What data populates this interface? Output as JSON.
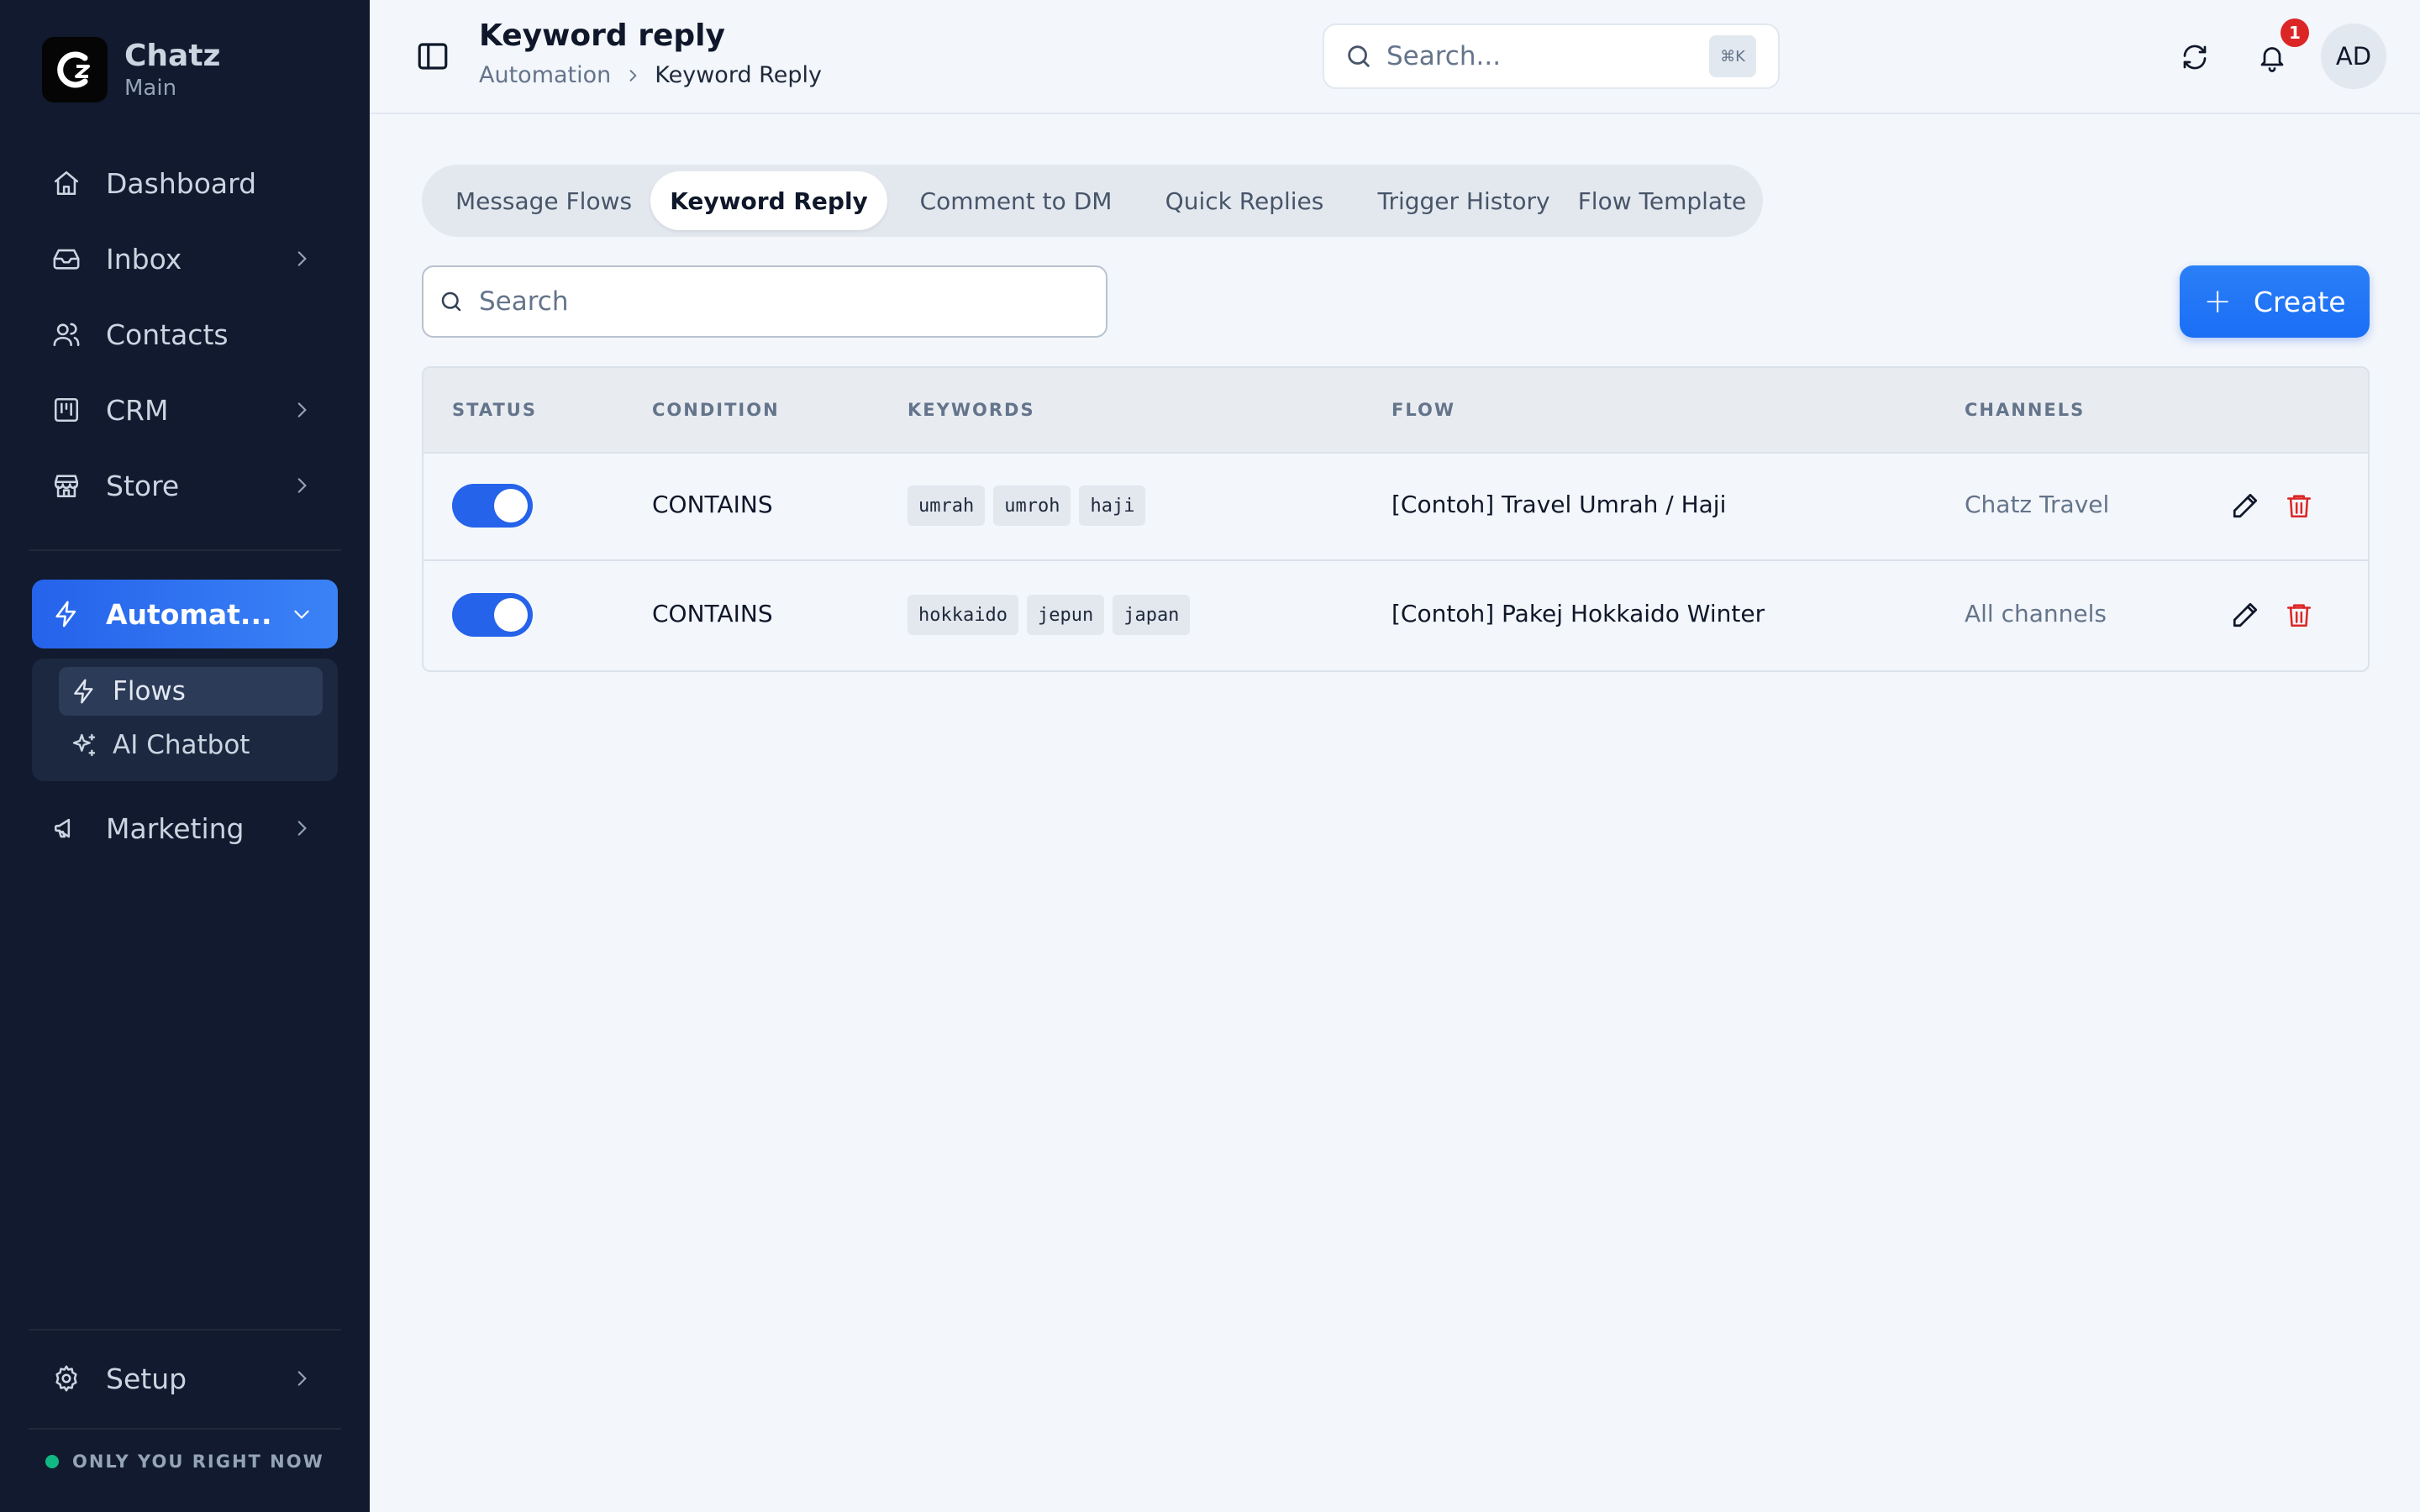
{
  "brand": {
    "name": "Chatz",
    "workspace": "Main",
    "logo_text": "C"
  },
  "sidebar": {
    "items": [
      {
        "label": "Dashboard",
        "icon": "home-icon"
      },
      {
        "label": "Inbox",
        "icon": "inbox-icon"
      },
      {
        "label": "Contacts",
        "icon": "users-icon"
      },
      {
        "label": "CRM",
        "icon": "kanban-icon"
      },
      {
        "label": "Store",
        "icon": "store-icon"
      },
      {
        "label": "Automat...",
        "icon": "zap-icon"
      },
      {
        "label": "Marketing",
        "icon": "megaphone-icon"
      },
      {
        "label": "Setup",
        "icon": "gear-icon"
      }
    ],
    "automation_sub": [
      {
        "label": "Flows",
        "icon": "zap-icon"
      },
      {
        "label": "AI Chatbot",
        "icon": "sparkles-icon"
      }
    ],
    "status": "ONLY YOU RIGHT NOW"
  },
  "header": {
    "title": "Keyword reply",
    "breadcrumb": [
      "Automation",
      "Keyword Reply"
    ],
    "search_placeholder": "Search...",
    "shortcut": "⌘K",
    "notification_count": "1",
    "avatar_initials": "AD"
  },
  "tabs": [
    {
      "label": "Message Flows"
    },
    {
      "label": "Keyword Reply"
    },
    {
      "label": "Comment to DM"
    },
    {
      "label": "Quick Replies"
    },
    {
      "label": "Trigger History"
    },
    {
      "label": "Flow Template"
    }
  ],
  "toolbar": {
    "search_placeholder": "Search",
    "create_label": "Create"
  },
  "table": {
    "columns": [
      "STATUS",
      "CONDITION",
      "KEYWORDS",
      "FLOW",
      "CHANNELS"
    ],
    "rows": [
      {
        "enabled": true,
        "condition": "CONTAINS",
        "keywords": [
          "umrah",
          "umroh",
          "haji"
        ],
        "flow": "[Contoh] Travel Umrah / Haji",
        "channels": "Chatz Travel"
      },
      {
        "enabled": true,
        "condition": "CONTAINS",
        "keywords": [
          "hokkaido",
          "jepun",
          "japan"
        ],
        "flow": "[Contoh] Pakej Hokkaido Winter",
        "channels": "All channels"
      }
    ]
  },
  "colors": {
    "sidebar_bg": "#111a2e",
    "accent": "#2563eb",
    "danger": "#dc2626",
    "online": "#10b981"
  }
}
